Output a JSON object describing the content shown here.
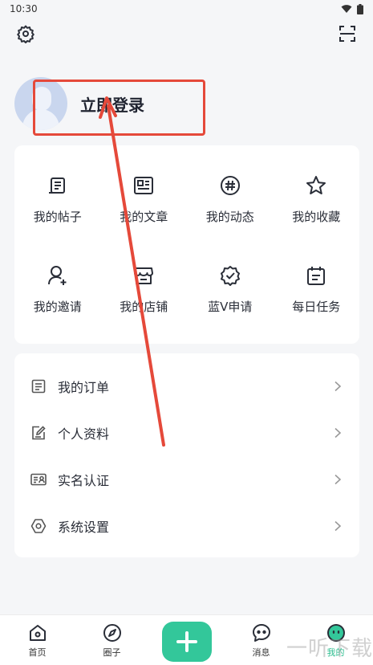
{
  "status": {
    "time": "10:30"
  },
  "profile": {
    "login_label": "立即登录"
  },
  "grid": [
    {
      "label": "我的帖子",
      "icon": "post-icon"
    },
    {
      "label": "我的文章",
      "icon": "article-icon"
    },
    {
      "label": "我的动态",
      "icon": "hashtag-icon"
    },
    {
      "label": "我的收藏",
      "icon": "star-icon"
    },
    {
      "label": "我的邀请",
      "icon": "invite-user-icon"
    },
    {
      "label": "我的店铺",
      "icon": "shop-icon"
    },
    {
      "label": "蓝V申请",
      "icon": "verified-badge-icon"
    },
    {
      "label": "每日任务",
      "icon": "calendar-task-icon"
    }
  ],
  "list": [
    {
      "label": "我的订单",
      "icon": "order-list-icon"
    },
    {
      "label": "个人资料",
      "icon": "edit-profile-icon"
    },
    {
      "label": "实名认证",
      "icon": "id-card-icon"
    },
    {
      "label": "系统设置",
      "icon": "settings-hex-icon"
    }
  ],
  "tabs": [
    {
      "label": "首页",
      "icon": "home-icon"
    },
    {
      "label": "圈子",
      "icon": "compass-icon"
    },
    {
      "label": "",
      "icon": "plus-icon"
    },
    {
      "label": "消息",
      "icon": "chat-icon"
    },
    {
      "label": "我的",
      "icon": "profile-face-icon"
    }
  ],
  "colors": {
    "accent": "#33c79a",
    "annotation": "#e5493a"
  },
  "watermark": "一听下载"
}
